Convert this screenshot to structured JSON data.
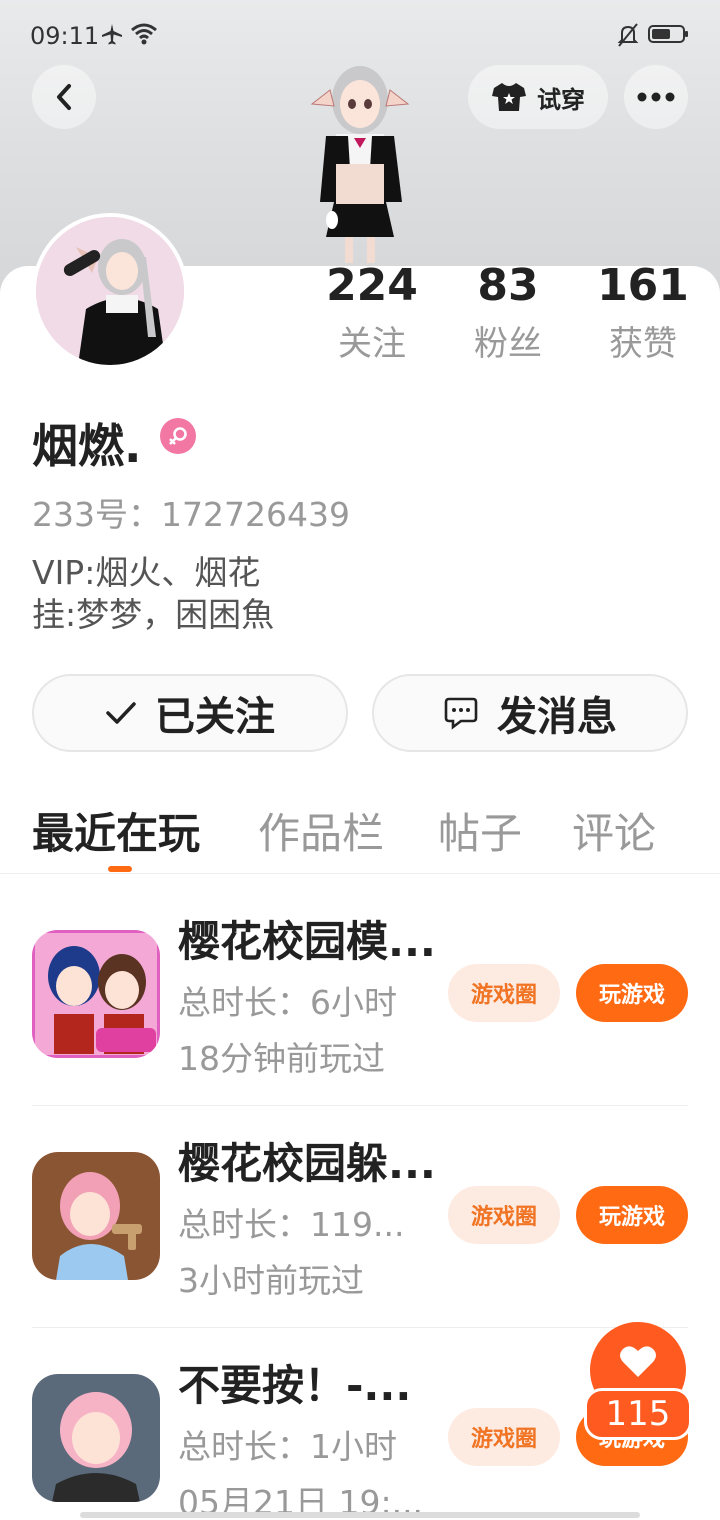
{
  "status_bar": {
    "time": "09:11"
  },
  "header": {
    "try_on_label": "试穿"
  },
  "profile": {
    "stats": [
      {
        "value": "224",
        "label": "关注"
      },
      {
        "value": "83",
        "label": "粉丝"
      },
      {
        "value": "161",
        "label": "获赞"
      }
    ],
    "nickname": "烟燃.",
    "uid": "233号：172726439",
    "bio_lines": [
      "VIP:烟火、烟花",
      "挂:梦梦，困困魚"
    ]
  },
  "actions": {
    "follow_label": "已关注",
    "message_label": "发消息"
  },
  "tabs": [
    "最近在玩",
    "作品栏",
    "帖子",
    "评论"
  ],
  "games": [
    {
      "title": "樱花校园模...",
      "duration": "总时长：6小时",
      "last_played": "18分钟前玩过",
      "circle_label": "游戏圈",
      "play_label": "玩游戏"
    },
    {
      "title": "樱花校园躲...",
      "duration": "总时长：119...",
      "last_played": "3小时前玩过",
      "circle_label": "游戏圈",
      "play_label": "玩游戏"
    },
    {
      "title": "不要按！-...",
      "duration": "总时长：1小时",
      "last_played": "05月21日 19:...",
      "circle_label": "游戏圈",
      "play_label": "玩游戏"
    }
  ],
  "like_fab": {
    "count": "115"
  },
  "colors": {
    "accent": "#ff6a13",
    "gender_badge": "#f277a3",
    "chip_bg": "#fdebe1"
  }
}
